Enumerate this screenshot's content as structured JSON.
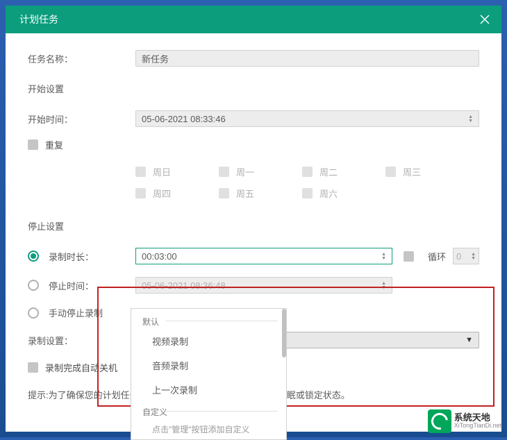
{
  "titlebar": {
    "title": "计划任务"
  },
  "task_name": {
    "label": "任务名称：",
    "value": "新任务"
  },
  "start_section": {
    "title": "开始设置",
    "start_time_label": "开始时间：",
    "start_time_value": "05-06-2021 08:33:46",
    "repeat_label": "重复",
    "days": [
      "周日",
      "周一",
      "周二",
      "周三",
      "周四",
      "周五",
      "周六"
    ]
  },
  "stop_section": {
    "title": "停止设置",
    "duration_label": "录制时长：",
    "duration_value": "00:03:00",
    "loop_label": "循环",
    "loop_value": "0",
    "stop_time_label": "停止时间：",
    "stop_time_value": "05-06-2021 08:36:48",
    "manual_stop_label": "手动停止录制"
  },
  "record_section": {
    "label": "录制设置：",
    "select_value": "视频录制",
    "auto_shutdown_label": "录制完成自动关机"
  },
  "dropdown": {
    "group_default": "默认",
    "items": [
      "视频录制",
      "音频录制",
      "上一次录制"
    ],
    "group_custom": "自定义",
    "hint": "点击\"管理\"按钮添加自定义"
  },
  "tip": {
    "text": "提示:为了确保您的计划任务",
    "text_suffix": "入睡眠或锁定状态。"
  },
  "watermark": {
    "cn": "系统天地",
    "en": "XiTongTianDi.net"
  }
}
